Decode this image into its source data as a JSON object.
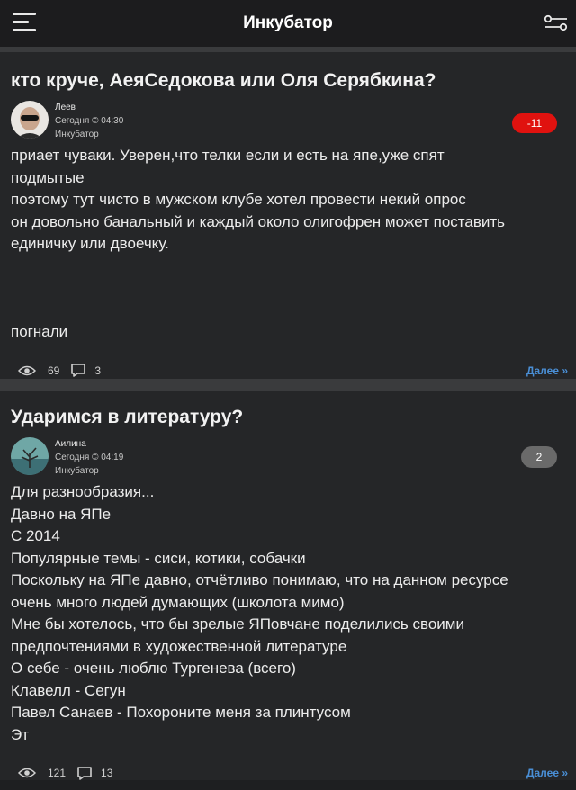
{
  "header": {
    "title": "Инкубатор"
  },
  "posts": [
    {
      "title": "кто круче, АеяСедокова или Оля Серябкина?",
      "author": "Леев",
      "time": "Сегодня © 04:30",
      "section": "Инкубатор",
      "rating": "-11",
      "lines": [
        "приает чуваки. Уверен,что телки если и есть на япе,уже спят",
        "подмытые",
        "поэтому тут чисто в мужском клубе хотел провести некий опрос",
        "он довольно банальный и каждый около олигофрен может поставить",
        "единичку или двоечку.",
        "",
        "",
        "",
        "погнали"
      ],
      "views": "69",
      "comments": "3",
      "more": "Далее »"
    },
    {
      "title": "Ударимся в литературу?",
      "author": "Аилина",
      "time": "Сегодня © 04:19",
      "section": "Инкубатор",
      "rating": "2",
      "lines": [
        "Для разнообразия...",
        "Давно на ЯПе",
        "С 2014",
        "Популярные темы - сиси, котики, собачки",
        "Поскольку на ЯПе давно, отчётливо понимаю, что на данном ресурсе",
        "очень много людей думающих (школота мимо)",
        "Мне бы хотелось, что бы зрелые ЯПовчане поделились своими",
        "предпочтениями в художественной литературе",
        "О себе - очень люблю Тургенева (всего)",
        "Клавелл - Сегун",
        "Павел Санаев - Похороните меня за плинтусом",
        "Эт"
      ],
      "views": "121",
      "comments": "13",
      "more": "Далее »"
    }
  ],
  "icons": [
    "menu-icon",
    "filter-icon",
    "eye-icon",
    "comment-icon"
  ]
}
